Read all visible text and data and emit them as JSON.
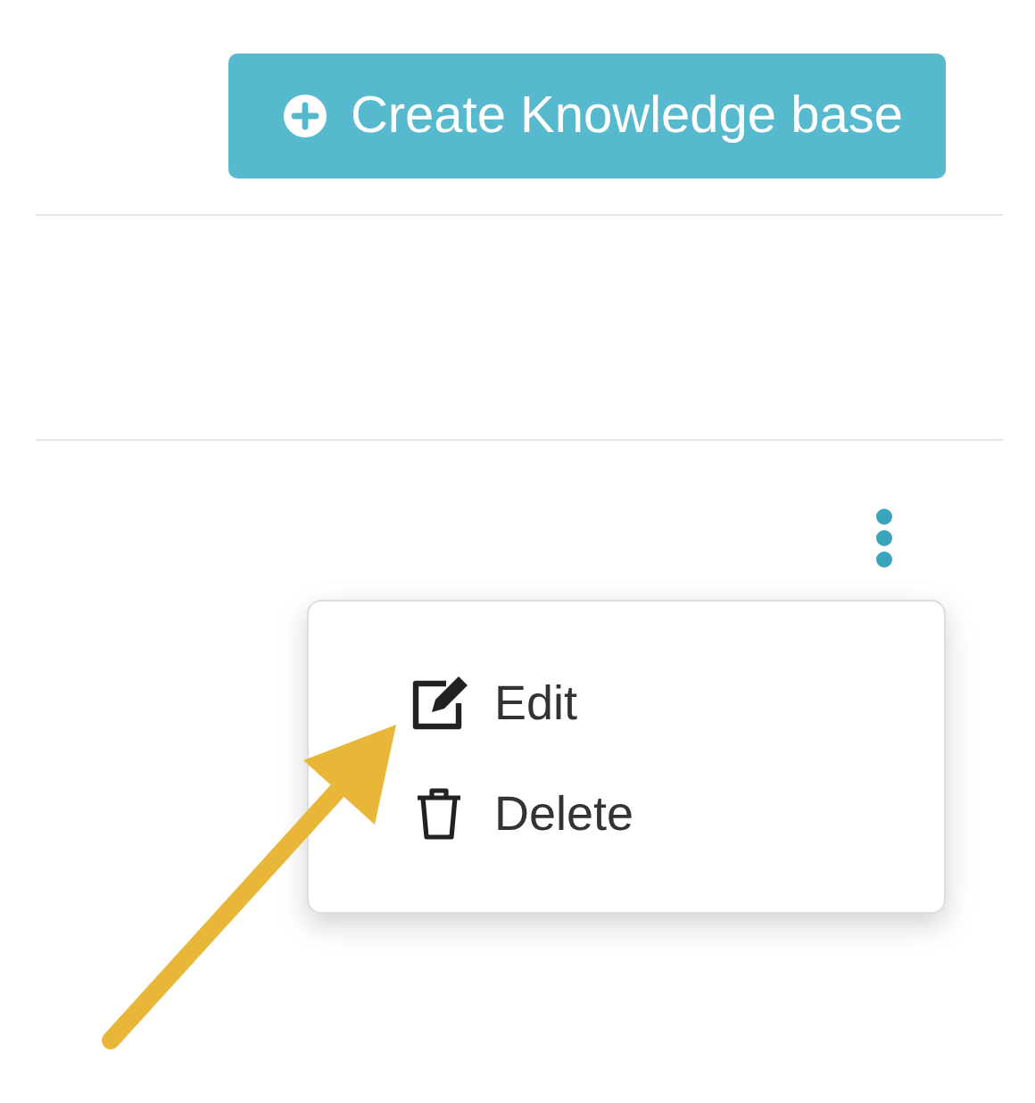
{
  "toolbar": {
    "create_button": {
      "label": "Create Knowledge base"
    }
  },
  "row_actions": {
    "trigger": {
      "expanded": true
    },
    "menu": [
      {
        "kind": "edit",
        "label": "Edit"
      },
      {
        "kind": "delete",
        "label": "Delete"
      }
    ]
  }
}
